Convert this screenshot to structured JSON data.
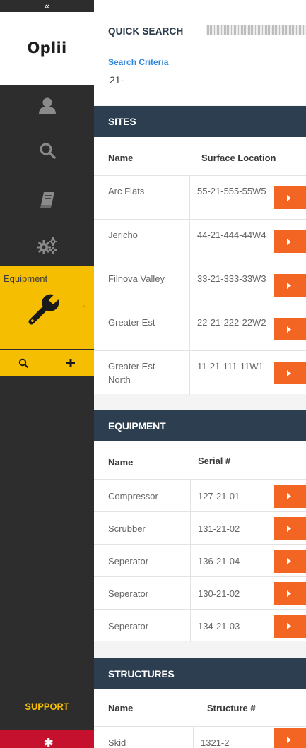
{
  "sidebar": {
    "collapse_glyph": "«",
    "logo": "Oplii",
    "nav_icons": [
      "user-icon",
      "search-icon",
      "book-icon",
      "gears-icon"
    ],
    "active_module": {
      "label": "Equipment",
      "icon": "wrench-icon",
      "actions": [
        "search-icon",
        "plus-icon"
      ]
    },
    "support_label": "SUPPORT",
    "colors": {
      "sidebar_bg": "#2d2d2d",
      "accent": "#f6be00",
      "alert": "#c5102e"
    }
  },
  "quick_search": {
    "title": "QUICK SEARCH",
    "criteria_label": "Search Criteria",
    "criteria_value": "21-"
  },
  "sites": {
    "title": "SITES",
    "columns": [
      "Name",
      "Surface Location"
    ],
    "rows": [
      {
        "name": "Arc Flats",
        "location": "55-21-555-55W5"
      },
      {
        "name": "Jericho",
        "location": "44-21-444-44W4"
      },
      {
        "name": "Filnova Valley",
        "location": "33-21-333-33W3"
      },
      {
        "name": "Greater Est",
        "location": "22-21-222-22W2"
      },
      {
        "name": "Greater Est-North",
        "location": "11-21-111-11W1"
      }
    ]
  },
  "equipment": {
    "title": "EQUIPMENT",
    "columns": [
      "Name",
      "Serial #"
    ],
    "rows": [
      {
        "name": "Compressor",
        "serial": "127-21-01"
      },
      {
        "name": "Scrubber",
        "serial": "131-21-02"
      },
      {
        "name": "Seperator",
        "serial": "136-21-04"
      },
      {
        "name": "Seperator",
        "serial": "130-21-02"
      },
      {
        "name": "Seperator",
        "serial": "134-21-03"
      }
    ]
  },
  "structures": {
    "title": "STRUCTURES",
    "columns": [
      "Name",
      "Structure #"
    ],
    "rows": [
      {
        "name": "Skid",
        "number": "1321-2"
      }
    ]
  },
  "colors": {
    "header_bg": "#2c3e50",
    "go_button": "#f26522",
    "link": "#2e86de"
  }
}
